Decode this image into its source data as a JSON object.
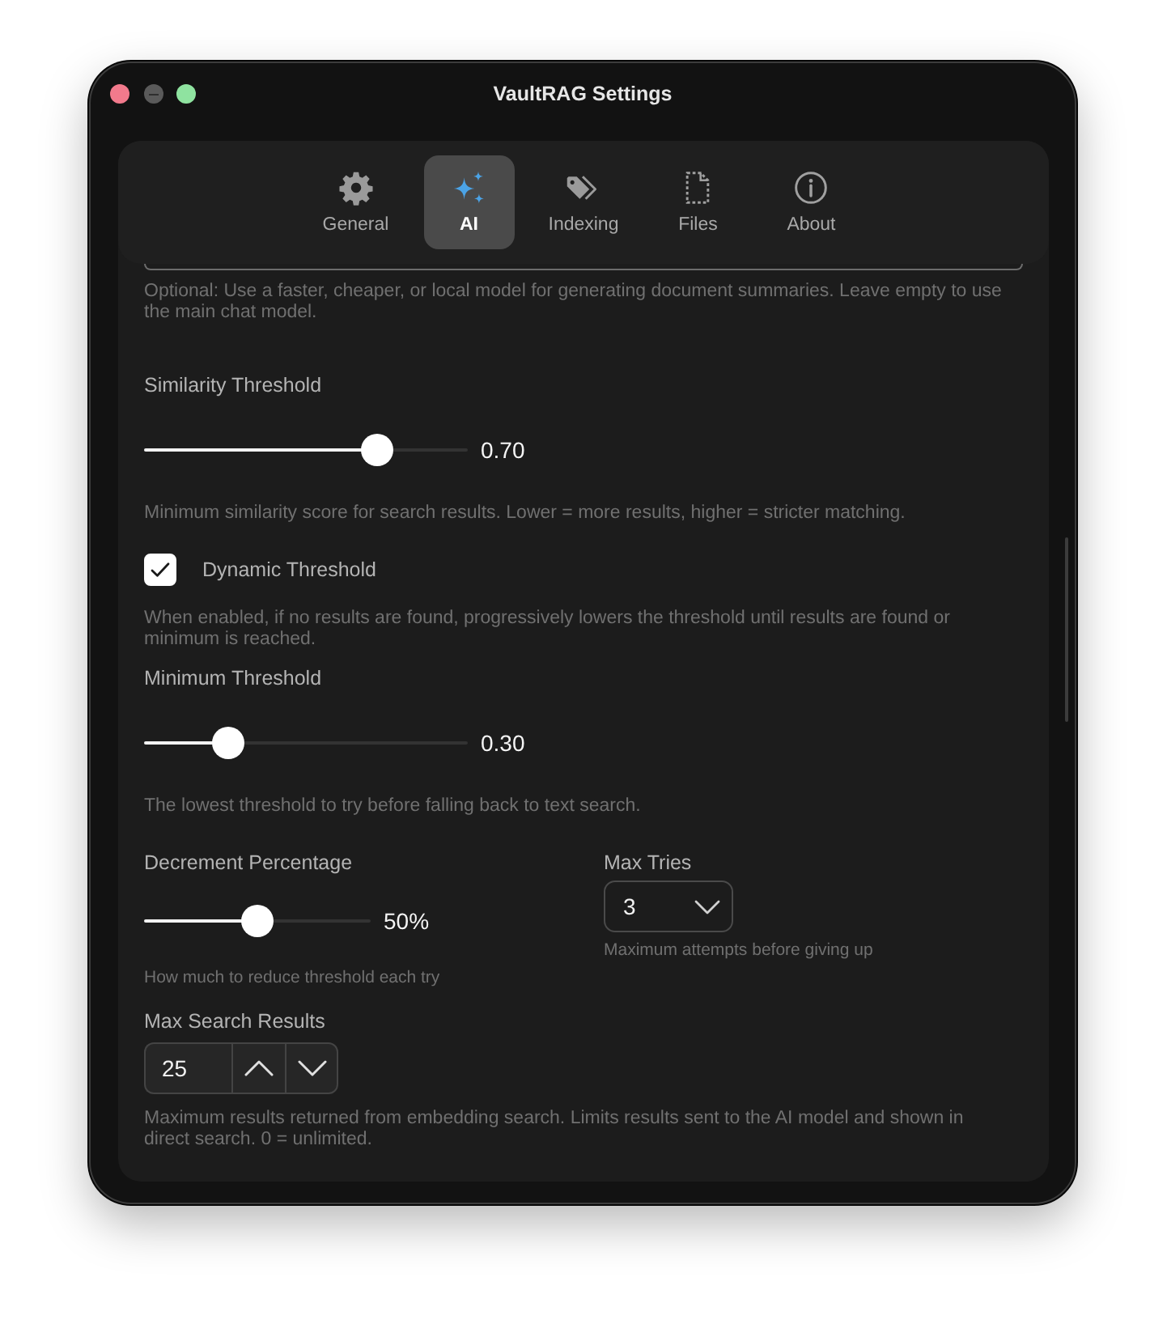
{
  "window": {
    "title": "VaultRAG Settings"
  },
  "tabs": [
    {
      "label": "General",
      "selected": false
    },
    {
      "label": "AI",
      "selected": true
    },
    {
      "label": "Indexing",
      "selected": false
    },
    {
      "label": "Files",
      "selected": false
    },
    {
      "label": "About",
      "selected": false
    }
  ],
  "settings": [
    {
      "kind": "input",
      "help": "Optional: Use a faster, cheaper, or local model for generating document summaries. Leave empty to use the main chat model."
    },
    {
      "kind": "slider",
      "label": "Similarity Threshold",
      "level": 0.72,
      "reading": "0.70",
      "help": "Minimum similarity score for search results. Lower = more results, higher = stricter matching."
    },
    {
      "kind": "checkbox",
      "label": "Dynamic Threshold",
      "checked": true,
      "help": "When enabled, if no results are found, progressively lowers the threshold until results are found or minimum is reached."
    },
    {
      "kind": "slider",
      "label": "Minimum Threshold",
      "level": 0.26,
      "reading": "0.30",
      "help": "The lowest threshold to try before falling back to text search."
    },
    {
      "kind": "columns",
      "columns": [
        {
          "kind": "slider",
          "label": "Decrement Percentage",
          "level": 0.5,
          "reading": "50%",
          "help": "How much to reduce threshold each try"
        },
        {
          "kind": "select",
          "label": "Max Tries",
          "value": "3",
          "help": "Maximum attempts before giving up"
        }
      ]
    },
    {
      "kind": "stepper",
      "label": "Max Search Results",
      "value": "25",
      "help": "Maximum results returned from embedding search. Limits results sent to the AI model and shown in direct search. 0 = unlimited."
    }
  ]
}
